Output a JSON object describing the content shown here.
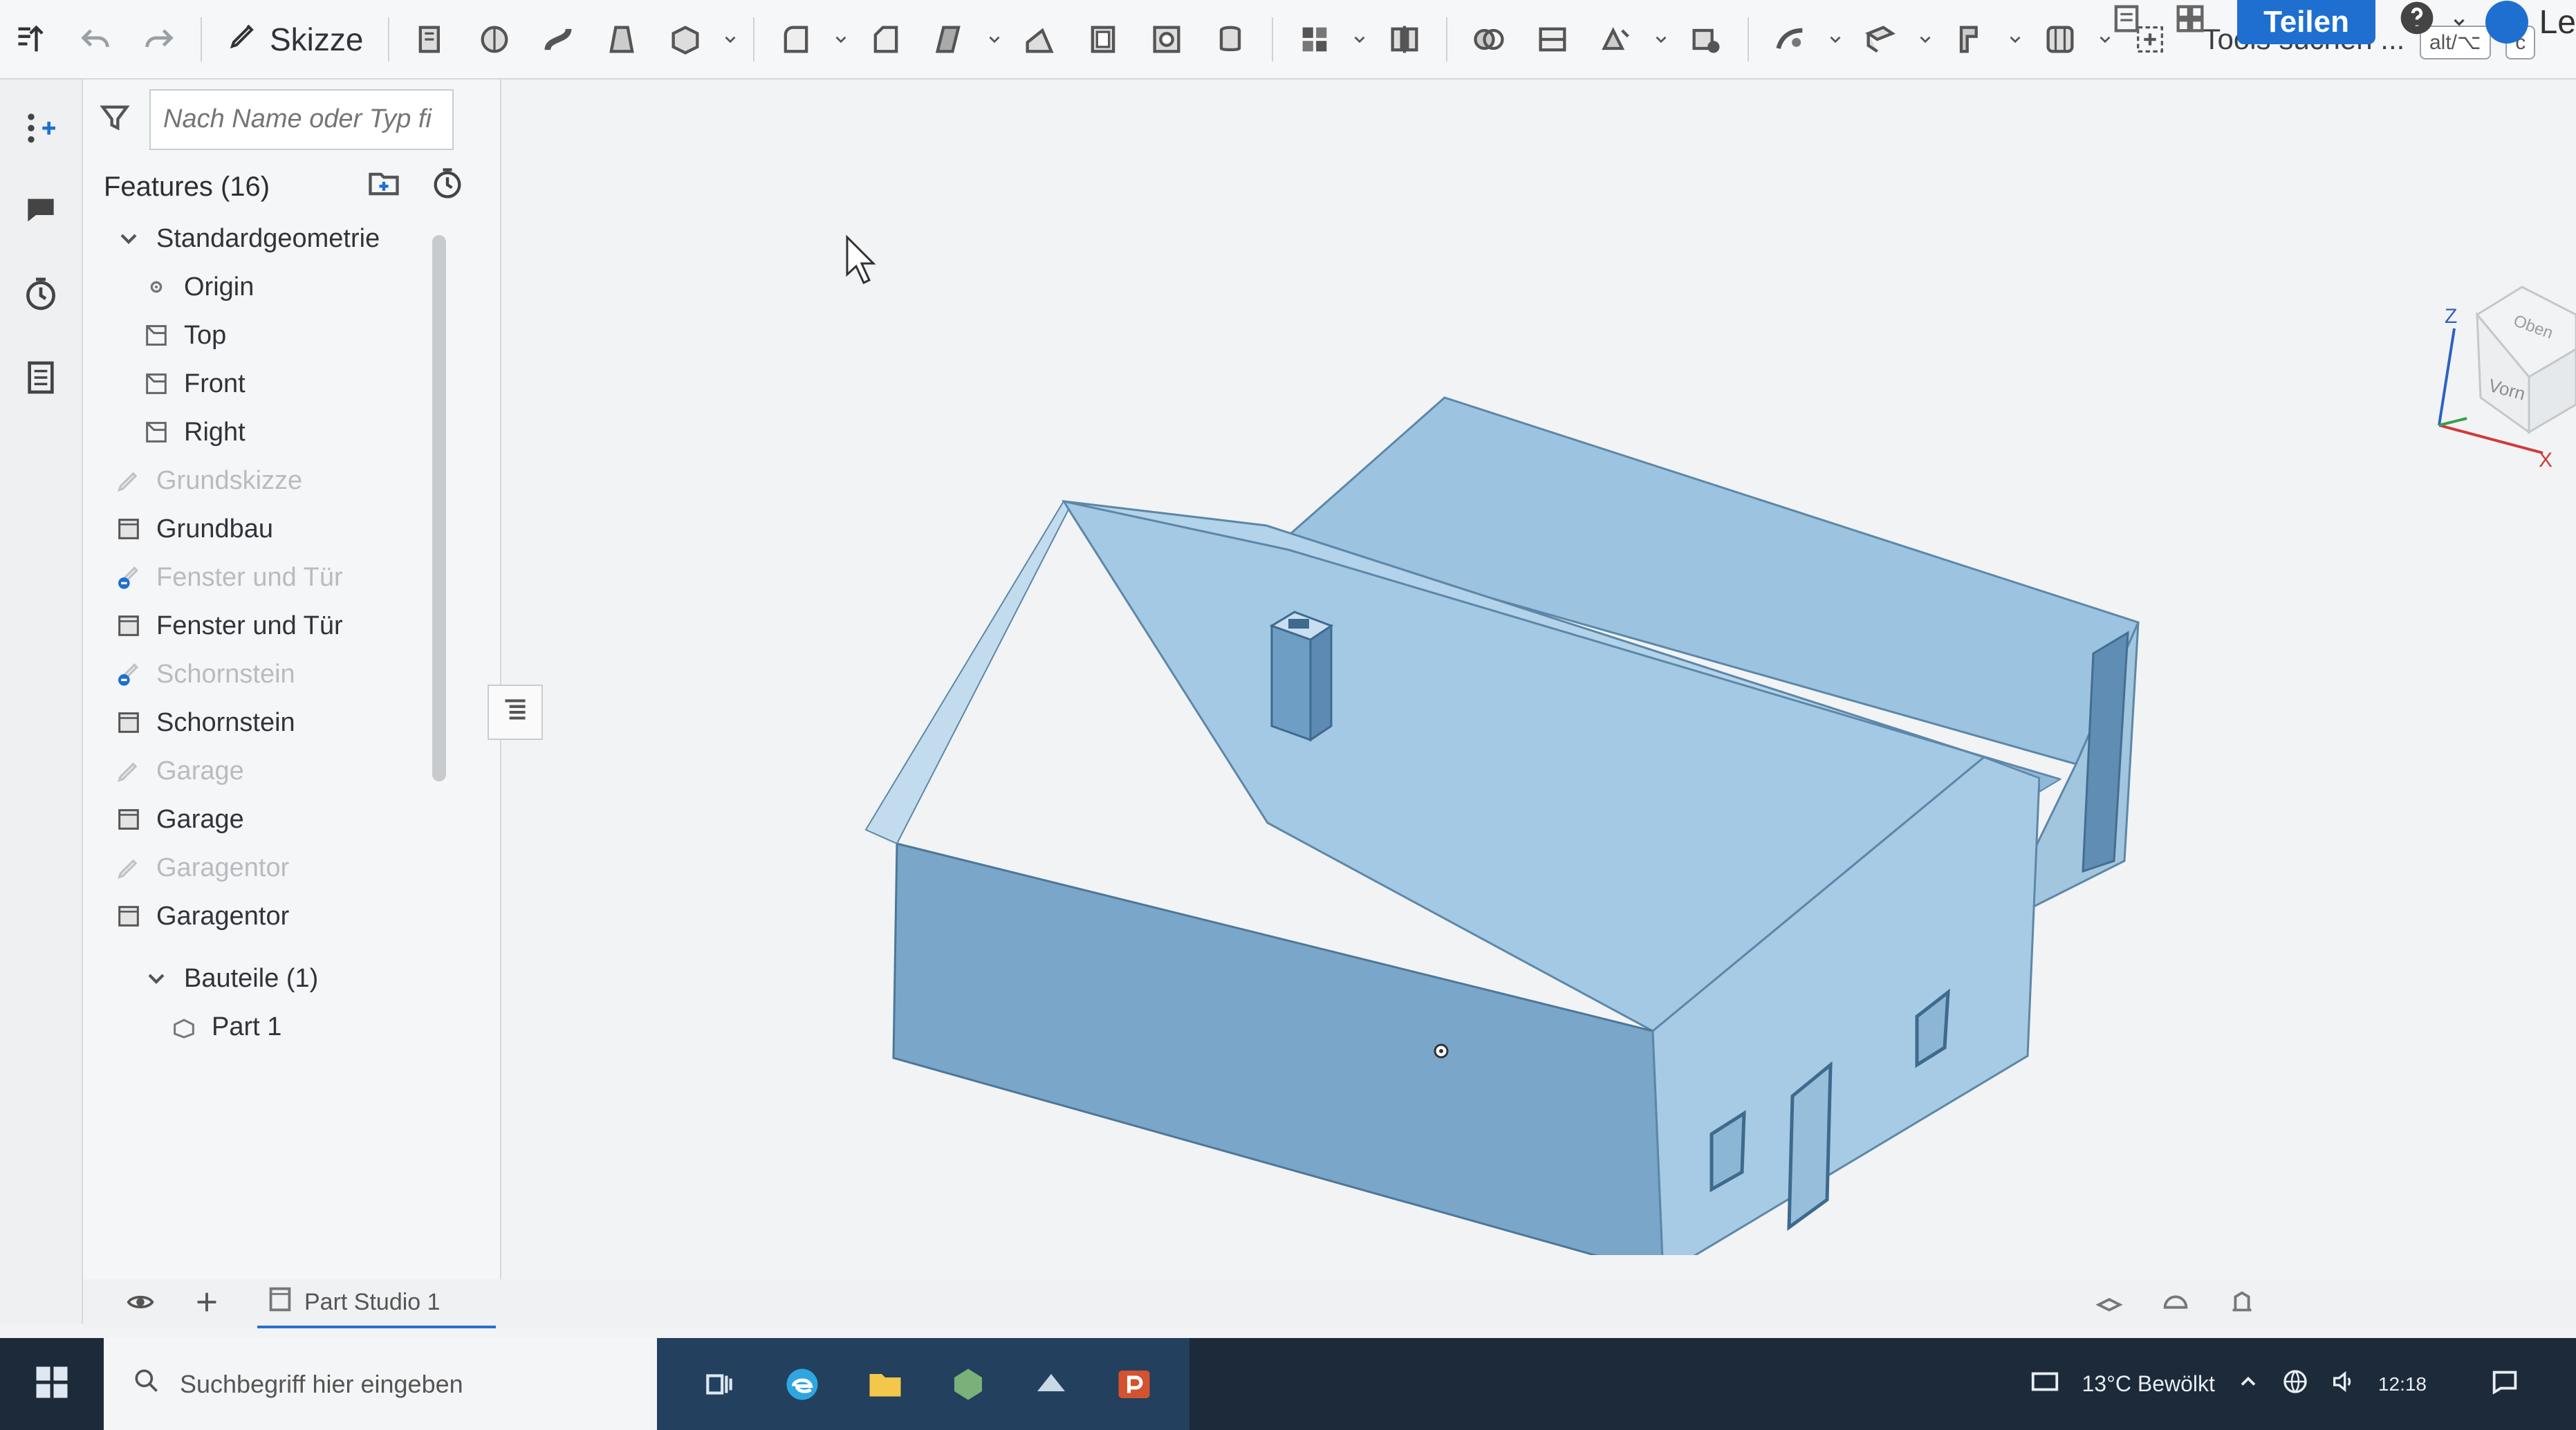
{
  "toolbar": {
    "sketch_label": "Skizze",
    "tools_search": "Tools suchen ...",
    "shortcut_1": "alt/⌥",
    "shortcut_2": "c",
    "share_label": "Teilen",
    "user_label": "Le"
  },
  "panel": {
    "search_placeholder": "Nach Name oder Typ fi",
    "features_title": "Features (16)",
    "tree": [
      {
        "label": "Standardgeometrie",
        "level": 0,
        "dim": false,
        "icon": "chevron-down-icon"
      },
      {
        "label": "Origin",
        "level": 1,
        "dim": false,
        "icon": "origin-icon"
      },
      {
        "label": "Top",
        "level": 1,
        "dim": false,
        "icon": "plane-icon"
      },
      {
        "label": "Front",
        "level": 1,
        "dim": false,
        "icon": "plane-icon"
      },
      {
        "label": "Right",
        "level": 1,
        "dim": false,
        "icon": "plane-icon"
      },
      {
        "label": "Grundskizze",
        "level": 0,
        "dim": true,
        "icon": "sketch-icon"
      },
      {
        "label": "Grundbau",
        "level": 0,
        "dim": false,
        "icon": "extrude-icon"
      },
      {
        "label": "Fenster und Tür",
        "level": 0,
        "dim": true,
        "icon": "sketch-error-icon"
      },
      {
        "label": "Fenster und Tür",
        "level": 0,
        "dim": false,
        "icon": "extrude-icon"
      },
      {
        "label": "Schornstein",
        "level": 0,
        "dim": true,
        "icon": "sketch-error-icon"
      },
      {
        "label": "Schornstein",
        "level": 0,
        "dim": false,
        "icon": "extrude-icon"
      },
      {
        "label": "Garage",
        "level": 0,
        "dim": true,
        "icon": "sketch-icon"
      },
      {
        "label": "Garage",
        "level": 0,
        "dim": false,
        "icon": "extrude-icon"
      },
      {
        "label": "Garagentor",
        "level": 0,
        "dim": true,
        "icon": "sketch-icon"
      },
      {
        "label": "Garagentor",
        "level": 0,
        "dim": false,
        "icon": "extrude-icon"
      }
    ],
    "parts_header": "Bauteile (1)",
    "part_item": "Part 1"
  },
  "viewcube": {
    "axis_z": "Z",
    "axis_x": "X",
    "face_top": "Oben",
    "face_front": "Vorn"
  },
  "tabs": {
    "part_studio": "Part Studio 1"
  },
  "taskbar": {
    "search_placeholder": "Suchbegriff hier eingeben",
    "weather": "13°C  Bewölkt",
    "time": "12:18"
  },
  "colors": {
    "accent": "#1f6fd1",
    "model_face_top": "#a8cde6",
    "model_face_front": "#6f9cc0",
    "model_face_side": "#8ab7d8",
    "taskbar": "#1d2a3a"
  }
}
